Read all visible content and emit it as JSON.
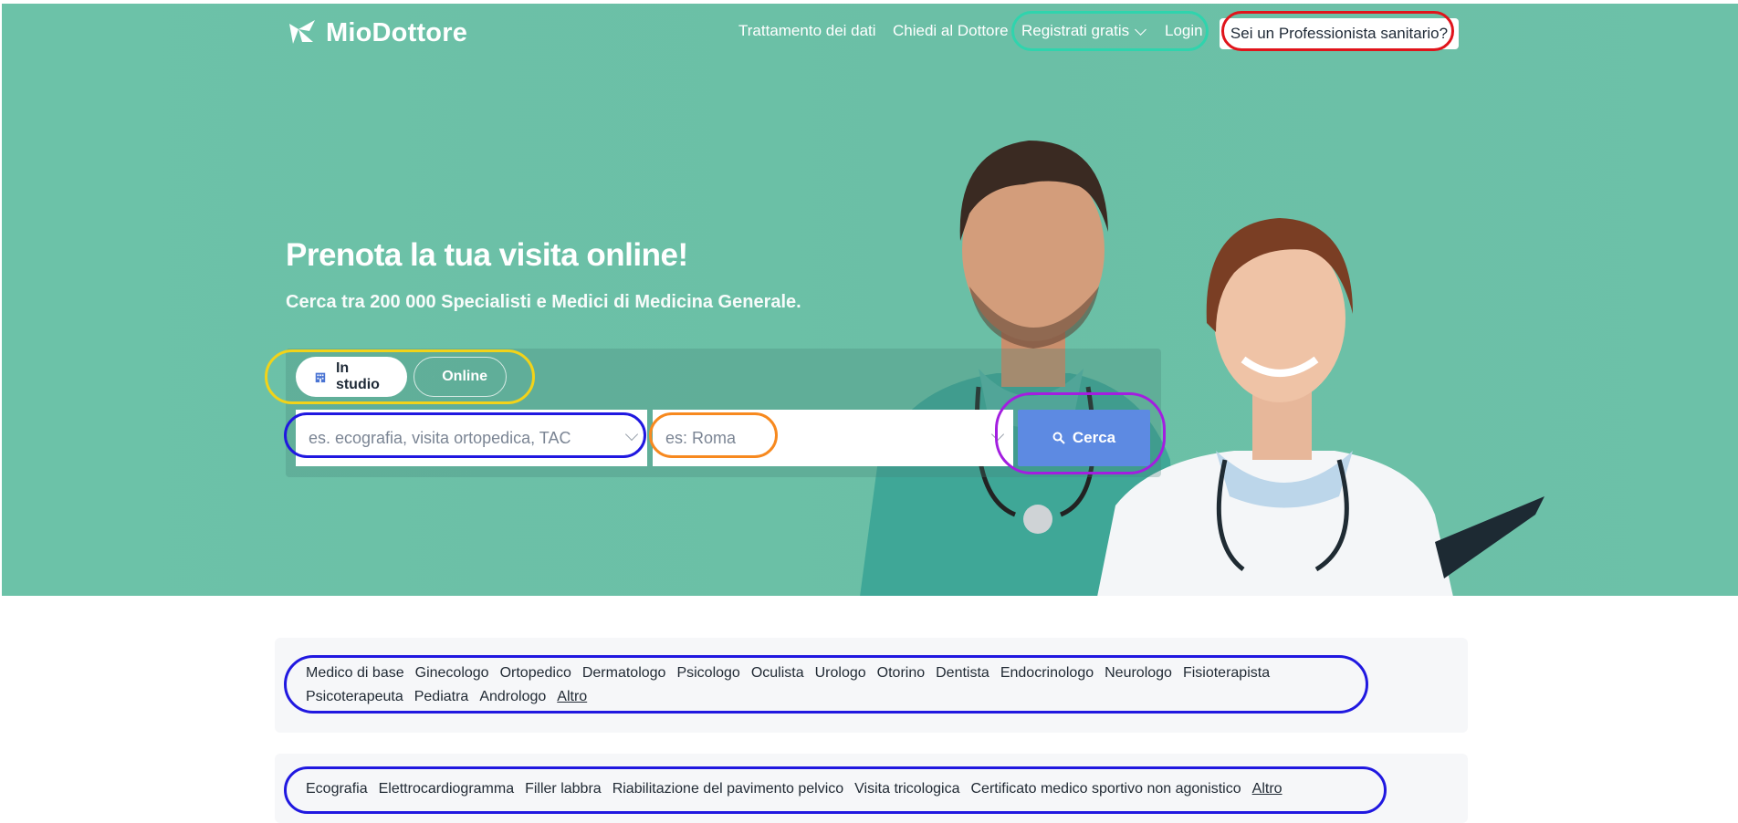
{
  "brand": {
    "name": "MioDottore"
  },
  "nav": {
    "trattamento": "Trattamento dei dati",
    "chiedi": "Chiedi al Dottore",
    "registrati": "Registrati gratis",
    "login": "Login",
    "professionista": "Sei un Professionista sanitario?"
  },
  "hero": {
    "title": "Prenota la tua visita online!",
    "subtitle": "Cerca tra 200 000 Specialisti e Medici di Medicina Generale."
  },
  "search": {
    "tab_studio": "In studio",
    "tab_online": "Online",
    "query_placeholder": "es. ecografia, visita ortopedica, TAC",
    "location_placeholder": "es: Roma",
    "button_label": "Cerca"
  },
  "specialties": {
    "row1": [
      "Medico di base",
      "Ginecologo",
      "Ortopedico",
      "Dermatologo",
      "Psicologo",
      "Oculista",
      "Urologo",
      "Otorino",
      "Dentista",
      "Endocrinologo",
      "Neurologo",
      "Fisioterapista"
    ],
    "row2": [
      "Psicoterapeuta",
      "Pediatra",
      "Andrologo"
    ],
    "more": "Altro"
  },
  "services": {
    "items": [
      "Ecografia",
      "Elettrocardiogramma",
      "Filler labbra",
      "Riabilitazione del pavimento pelvico",
      "Visita tricologica",
      "Certificato medico sportivo non agonistico"
    ],
    "more": "Altro"
  },
  "colors": {
    "hero_bg": "#6cc2a8",
    "search_button": "#5d8ae2",
    "annotation_teal": "#2fd4ad",
    "annotation_red": "#e0141b",
    "annotation_yellow": "#f2d319",
    "annotation_blue": "#2018e0",
    "annotation_orange": "#f7891f",
    "annotation_purple": "#a31ee0"
  }
}
